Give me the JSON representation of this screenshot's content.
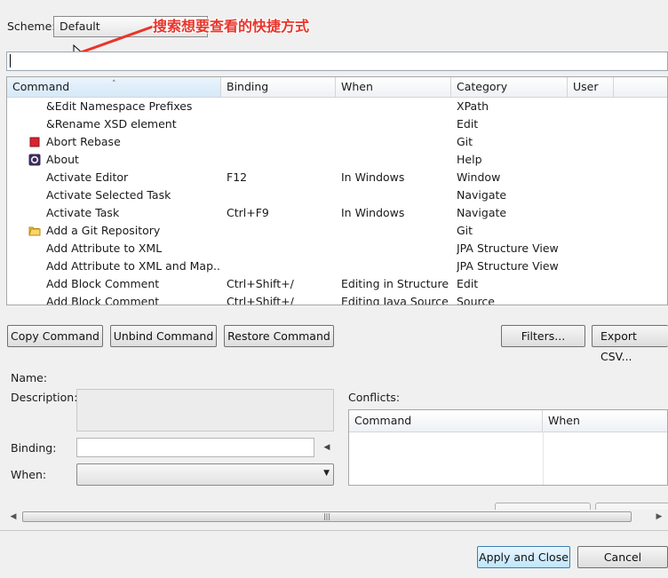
{
  "scheme": {
    "label": "Scheme:",
    "value": "Default"
  },
  "annotation": {
    "text": "搜索想要查看的快捷方式",
    "color": "#e8352b"
  },
  "filter": {
    "value": ""
  },
  "table": {
    "columns": [
      "Command",
      "Binding",
      "When",
      "Category",
      "User"
    ],
    "rows": [
      {
        "icon": "",
        "command": "&Edit Namespace Prefixes",
        "binding": "",
        "when": "",
        "category": "XPath"
      },
      {
        "icon": "",
        "command": "&Rename XSD element",
        "binding": "",
        "when": "",
        "category": "Edit"
      },
      {
        "icon": "red-square-icon",
        "command": "Abort Rebase",
        "binding": "",
        "when": "",
        "category": "Git"
      },
      {
        "icon": "eclipse-icon",
        "command": "About",
        "binding": "",
        "when": "",
        "category": "Help"
      },
      {
        "icon": "",
        "command": "Activate Editor",
        "binding": "F12",
        "when": "In Windows",
        "category": "Window"
      },
      {
        "icon": "",
        "command": "Activate Selected Task",
        "binding": "",
        "when": "",
        "category": "Navigate"
      },
      {
        "icon": "",
        "command": "Activate Task",
        "binding": "Ctrl+F9",
        "when": "In Windows",
        "category": "Navigate"
      },
      {
        "icon": "folder-icon",
        "command": "Add a Git Repository",
        "binding": "",
        "when": "",
        "category": "Git"
      },
      {
        "icon": "",
        "command": "Add Attribute to XML",
        "binding": "",
        "when": "",
        "category": "JPA Structure View"
      },
      {
        "icon": "",
        "command": "Add Attribute to XML and Map...",
        "binding": "",
        "when": "",
        "category": "JPA Structure View"
      },
      {
        "icon": "",
        "command": "Add Block Comment",
        "binding": "Ctrl+Shift+/",
        "when": "Editing in Structure...",
        "category": "Edit"
      },
      {
        "icon": "",
        "command": "Add Block Comment",
        "binding": "Ctrl+Shift+/",
        "when": "Editing Java Source",
        "category": "Source"
      }
    ]
  },
  "buttons": {
    "copy": "Copy Command",
    "unbind": "Unbind Command",
    "restore": "Restore Command",
    "filters": "Filters...",
    "export": "Export CSV..."
  },
  "details": {
    "name_label": "Name:",
    "description_label": "Description:",
    "binding_label": "Binding:",
    "when_label": "When:",
    "conflicts_label": "Conflicts:",
    "conflict_columns": [
      "Command",
      "When"
    ]
  },
  "footer": {
    "apply": "Apply and Close",
    "cancel": "Cancel"
  }
}
